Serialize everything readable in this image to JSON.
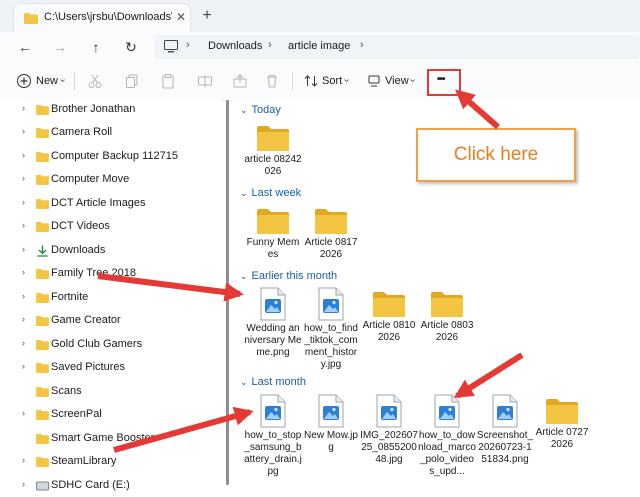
{
  "window": {
    "tab_title": "C:\\Users\\jrsbu\\Downloads\\art",
    "close_glyph": "✕",
    "newtab_glyph": "+"
  },
  "nav": {
    "back": "←",
    "forward": "→",
    "up": "↑",
    "refresh": "↻"
  },
  "breadcrumbs": [
    "Downloads",
    "article image"
  ],
  "breadcrumb_sep": "›",
  "toolbar": {
    "new_label": "New",
    "sort_label": "Sort",
    "view_label": "View",
    "more_label": "•••",
    "dropdown_glyph": "⌄"
  },
  "sidebar": {
    "items": [
      {
        "label": "Brother Jonathan",
        "icon": "folder-icon"
      },
      {
        "label": "Camera Roll",
        "icon": "folder-icon"
      },
      {
        "label": "Computer Backup 112715",
        "icon": "folder-icon"
      },
      {
        "label": "Computer Move",
        "icon": "folder-icon"
      },
      {
        "label": "DCT Article Images",
        "icon": "folder-icon"
      },
      {
        "label": "DCT Videos",
        "icon": "folder-icon"
      },
      {
        "label": "Downloads",
        "icon": "download-icon"
      },
      {
        "label": "Family Tree 2018",
        "icon": "folder-icon"
      },
      {
        "label": "Fortnite",
        "icon": "folder-icon"
      },
      {
        "label": "Game Creator",
        "icon": "folder-icon"
      },
      {
        "label": "Gold Club Gamers",
        "icon": "folder-icon"
      },
      {
        "label": "Saved Pictures",
        "icon": "folder-icon"
      },
      {
        "label": "Scans",
        "icon": "folder-icon"
      },
      {
        "label": "ScreenPal",
        "icon": "folder-icon"
      },
      {
        "label": "Smart Game Booster",
        "icon": "folder-icon"
      },
      {
        "label": "SteamLibrary",
        "icon": "folder-icon"
      },
      {
        "label": "SDHC Card (E:)",
        "icon": "drive-icon"
      }
    ],
    "chevron": "›"
  },
  "groups": [
    {
      "name": "Today",
      "files": [
        {
          "name": "article 08242026",
          "type": "folder"
        }
      ]
    },
    {
      "name": "Last week",
      "files": [
        {
          "name": "Funny Memes",
          "type": "folder"
        },
        {
          "name": "Article 08172026",
          "type": "folder"
        }
      ]
    },
    {
      "name": "Earlier this month",
      "files": [
        {
          "name": "Wedding anniversary Meme.png",
          "type": "image"
        },
        {
          "name": "how_to_find_tiktok_comment_history.jpg",
          "type": "image"
        },
        {
          "name": "Article 08102026",
          "type": "folder"
        },
        {
          "name": "Article 08032026",
          "type": "folder"
        }
      ]
    },
    {
      "name": "Last month",
      "files": [
        {
          "name": "how_to_stop_samsung_battery_drain.jpg",
          "type": "image"
        },
        {
          "name": "New Mow.jpg",
          "type": "image"
        },
        {
          "name": "IMG_20260725_085520048.jpg",
          "type": "image"
        },
        {
          "name": "how_to_download_marco_polo_videos_upd...",
          "type": "image"
        },
        {
          "name": "Screenshot_20260723-151834.png",
          "type": "image"
        },
        {
          "name": "Article 07272026",
          "type": "folder"
        }
      ]
    }
  ],
  "group_chevron": "⌄",
  "annotation": {
    "callout_text": "Click here",
    "arrow_color": "#e53935",
    "callout_color": "#e67e22"
  },
  "colors": {
    "folder": "#f4c542",
    "folder_dark": "#e0a921",
    "accent": "#1c5ea8",
    "image_blue": "#2f7fd6"
  }
}
